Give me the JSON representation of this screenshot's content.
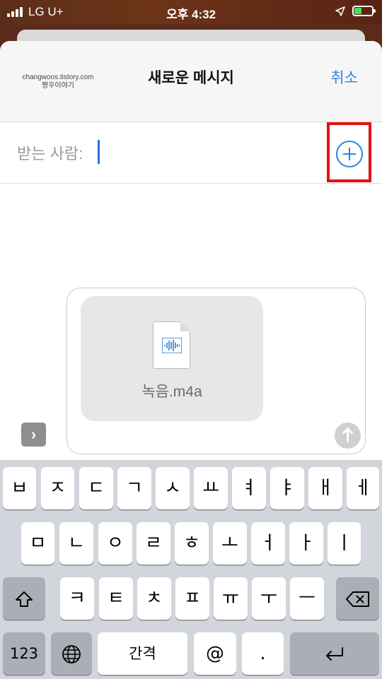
{
  "status_bar": {
    "carrier": "LG U+",
    "time": "오후 4:32",
    "battery_color": "#4cd964"
  },
  "header": {
    "watermark_line1": "changwoos.tistory.com",
    "watermark_line2": "짱우이야기",
    "title": "새로운 메시지",
    "cancel_label": "취소"
  },
  "recipient": {
    "label": "받는 사람:",
    "add_icon": "plus-circle-icon"
  },
  "compose": {
    "attachment_name": "녹음.m4a",
    "attachment_icon": "audio-file-icon",
    "expand_icon": "chevron-right-icon",
    "send_icon": "arrow-up-icon"
  },
  "keyboard": {
    "row1": [
      "ㅂ",
      "ㅈ",
      "ㄷ",
      "ㄱ",
      "ㅅ",
      "ㅛ",
      "ㅕ",
      "ㅑ",
      "ㅐ",
      "ㅔ"
    ],
    "row2": [
      "ㅁ",
      "ㄴ",
      "ㅇ",
      "ㄹ",
      "ㅎ",
      "ㅗ",
      "ㅓ",
      "ㅏ",
      "ㅣ"
    ],
    "row3": [
      "ㅋ",
      "ㅌ",
      "ㅊ",
      "ㅍ",
      "ㅠ",
      "ㅜ",
      "ㅡ"
    ],
    "numbers_label": "123",
    "space_label": "간격",
    "at_label": "@",
    "period_label": ".",
    "shift_icon": "shift-icon",
    "delete_icon": "backspace-icon",
    "globe_icon": "globe-icon",
    "return_icon": "return-icon"
  },
  "colors": {
    "accent": "#2e86de",
    "highlight": "#e21212"
  }
}
